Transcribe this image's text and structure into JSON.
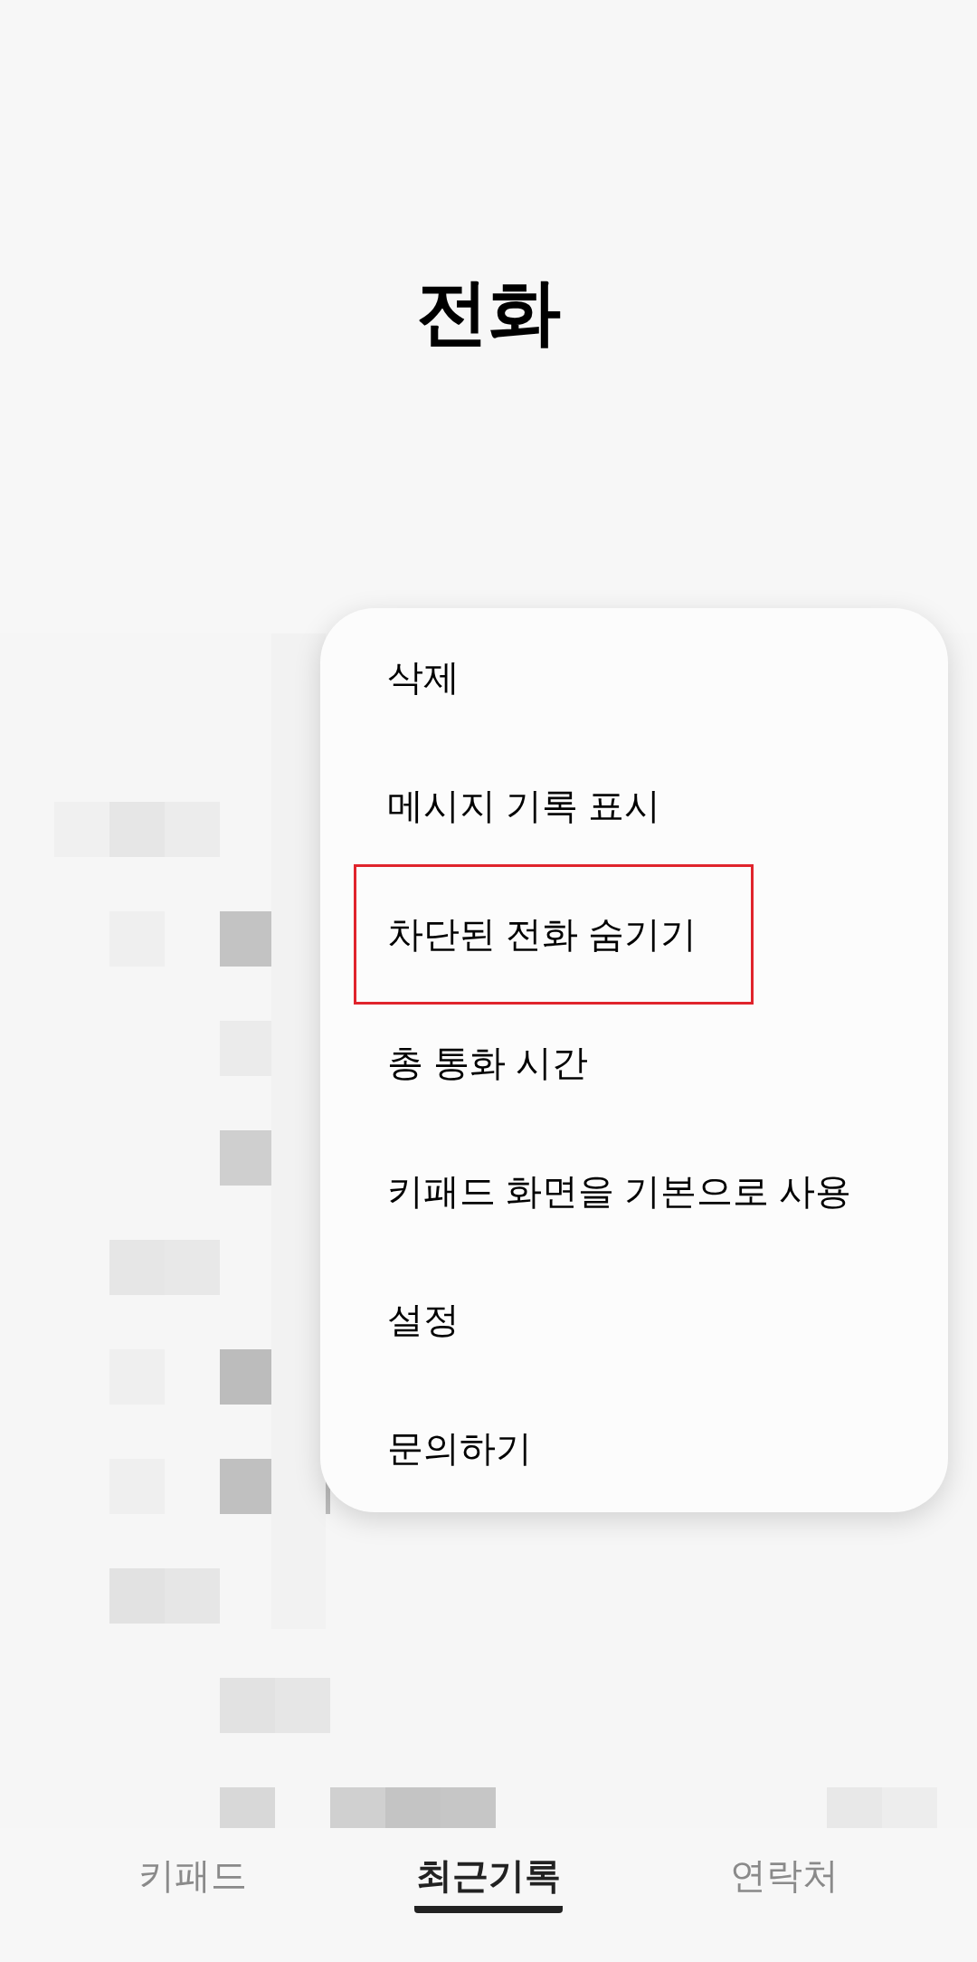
{
  "app_title": "전화",
  "menu": [
    {
      "label": "삭제",
      "highlighted": false
    },
    {
      "label": "메시지 기록 표시",
      "highlighted": false
    },
    {
      "label": "차단된 전화 숨기기",
      "highlighted": true
    },
    {
      "label": "총 통화 시간",
      "highlighted": false
    },
    {
      "label": "키패드 화면을 기본으로 사용",
      "highlighted": false
    },
    {
      "label": "설정",
      "highlighted": false
    },
    {
      "label": "문의하기",
      "highlighted": false
    }
  ],
  "tabs": [
    {
      "label": "키패드",
      "selected": false
    },
    {
      "label": "최근기록",
      "selected": true
    },
    {
      "label": "연락처",
      "selected": false
    }
  ]
}
